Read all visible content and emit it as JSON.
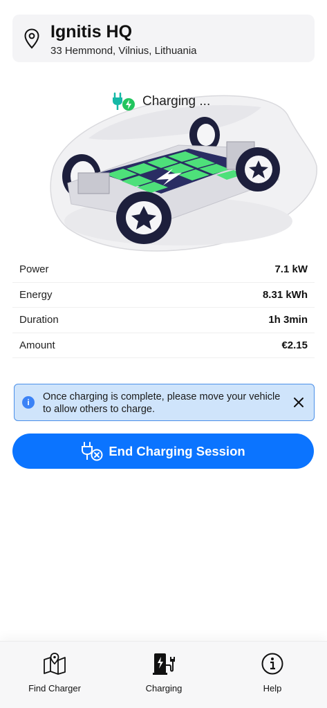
{
  "location": {
    "title": "Ignitis HQ",
    "address": "33 Hemmond, Vilnius, Lithuania",
    "icon": "map-pin-icon"
  },
  "status": {
    "text": "Charging ...",
    "icon": "charging-plug-icon",
    "accent": "#22c55e"
  },
  "stats": [
    {
      "label": "Power",
      "value": "7.1 kW"
    },
    {
      "label": "Energy",
      "value": "8.31 kWh"
    },
    {
      "label": "Duration",
      "value": "1h 3min"
    },
    {
      "label": "Amount",
      "value": "€2.15"
    }
  ],
  "banner": {
    "text": "Once charging is complete, please move your vehicle to allow others to charge.",
    "icon": "info-icon",
    "close_icon": "close-icon",
    "background": "#cfe4fb",
    "border": "#4a8fe8"
  },
  "end_button": {
    "label": "End Charging Session",
    "icon": "unplug-icon",
    "color": "#0b74ff"
  },
  "tabs": [
    {
      "label": "Find Charger",
      "icon": "map-icon"
    },
    {
      "label": "Charging",
      "icon": "charging-station-icon"
    },
    {
      "label": "Help",
      "icon": "info-circle-icon"
    }
  ]
}
